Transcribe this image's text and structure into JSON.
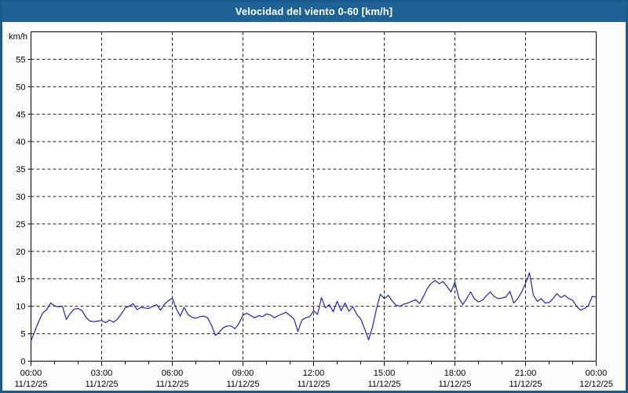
{
  "window": {
    "title": "Velocidad del viento 0-60 [km/h]"
  },
  "colors": {
    "titlebar_bg": "#1e6296",
    "window_border": "#1a5a8c",
    "page_bg": "#fcfdfb",
    "plot_bg": "#ffffff",
    "grid": "#1f1f1f",
    "axis": "#000000",
    "line": "#2222bb",
    "title_text": "#ffffff",
    "label_text": "#000000"
  },
  "chart_data": {
    "type": "line",
    "title": "Velocidad del viento 0-60 [km/h]",
    "ylabel": "km/h",
    "xlabel": "",
    "ylim": [
      0,
      60
    ],
    "y_ticks": [
      0,
      5,
      10,
      15,
      20,
      25,
      30,
      35,
      40,
      45,
      50,
      55
    ],
    "grid": "dashed",
    "legend": "none",
    "x_ticks": [
      {
        "time": "00:00",
        "date": "11/12/25"
      },
      {
        "time": "03:00",
        "date": "11/12/25"
      },
      {
        "time": "06:00",
        "date": "11/12/25"
      },
      {
        "time": "09:00",
        "date": "11/12/25"
      },
      {
        "time": "12:00",
        "date": "11/12/25"
      },
      {
        "time": "15:00",
        "date": "11/12/25"
      },
      {
        "time": "18:00",
        "date": "11/12/25"
      },
      {
        "time": "21:00",
        "date": "11/12/25"
      },
      {
        "time": "00:00",
        "date": "12/12/25"
      }
    ],
    "x_major_tick_hours": 3,
    "x_minor_tick_hours": 1,
    "xlim_hours": [
      0,
      24
    ],
    "series": [
      {
        "name": "Velocidad del viento",
        "x_start_minute": 0,
        "x_step_minutes": 10,
        "values": [
          3.7,
          5.5,
          7.3,
          8.8,
          9.4,
          10.6,
          10.1,
          9.9,
          10.0,
          7.6,
          8.7,
          9.5,
          9.6,
          9.2,
          8.0,
          7.3,
          7.2,
          7.3,
          7.4,
          7.0,
          7.5,
          7.1,
          7.6,
          8.6,
          9.7,
          10.0,
          10.5,
          9.4,
          9.8,
          9.7,
          9.6,
          10.0,
          10.3,
          9.3,
          10.4,
          11.0,
          11.5,
          9.6,
          8.2,
          9.8,
          8.5,
          8.0,
          7.8,
          8.1,
          8.2,
          7.9,
          6.5,
          4.7,
          5.3,
          6.1,
          6.4,
          6.4,
          5.9,
          6.9,
          8.4,
          8.7,
          8.3,
          7.9,
          8.3,
          8.1,
          8.6,
          8.4,
          7.9,
          8.3,
          8.6,
          8.9,
          8.3,
          7.7,
          5.4,
          7.5,
          7.9,
          8.1,
          9.2,
          8.5,
          11.6,
          9.7,
          10.3,
          9.0,
          10.9,
          9.2,
          10.6,
          9.1,
          9.9,
          8.5,
          7.7,
          5.9,
          3.9,
          6.2,
          9.5,
          12.2,
          11.4,
          12.0,
          11.0,
          10.2,
          10.0,
          10.4,
          10.6,
          10.9,
          11.2,
          10.5,
          11.8,
          13.3,
          14.2,
          14.7,
          14.1,
          14.5,
          13.6,
          12.6,
          14.4,
          11.5,
          10.3,
          11.4,
          12.6,
          11.3,
          10.8,
          11.1,
          11.9,
          12.6,
          11.8,
          11.4,
          11.5,
          11.7,
          12.7,
          10.6,
          11.4,
          12.6,
          14.2,
          16.1,
          12.0,
          10.9,
          11.4,
          10.6,
          10.7,
          11.4,
          12.3,
          11.6,
          12.0,
          11.4,
          11.1,
          10.0,
          9.3,
          9.6,
          10.1,
          11.8,
          11.7
        ]
      }
    ]
  }
}
